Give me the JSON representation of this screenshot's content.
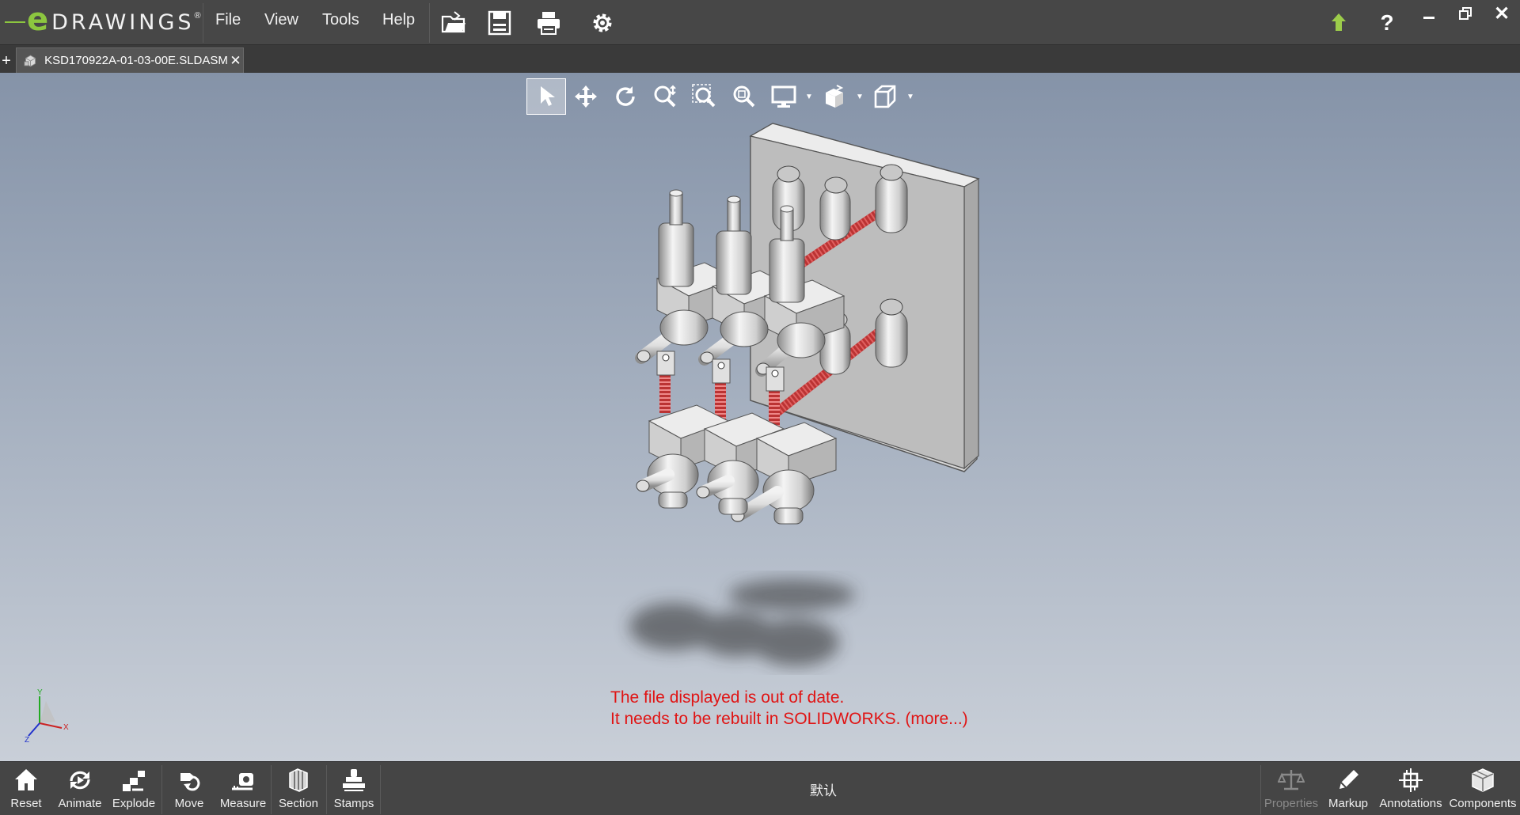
{
  "app": {
    "logo_mark": "e",
    "logo_text": "DRAWINGS",
    "logo_trademark": "®"
  },
  "menu": [
    "File",
    "View",
    "Tools",
    "Help"
  ],
  "toolbar_icons": [
    "open-folder-icon",
    "save-icon",
    "print-icon",
    "settings-gear-icon"
  ],
  "window_controls": [
    "update-arrow-icon",
    "help-icon",
    "minimize-icon",
    "restore-icon",
    "close-icon"
  ],
  "window": {
    "help": "?",
    "close": "✕"
  },
  "tabs": {
    "new_tab": "+",
    "document": {
      "name": "KSD170922A-01-03-00E.SLDASM",
      "close": "✕"
    }
  },
  "view_tools": [
    {
      "icon": "select-arrow-icon",
      "active": true
    },
    {
      "icon": "pan-icon"
    },
    {
      "icon": "rotate-icon"
    },
    {
      "icon": "zoom-icon"
    },
    {
      "icon": "zoom-to-area-icon"
    },
    {
      "icon": "zoom-to-fit-icon"
    },
    {
      "icon": "display-style-icon",
      "dropdown": true
    },
    {
      "icon": "views-icon",
      "dropdown": true
    },
    {
      "icon": "standard-view-cube-icon",
      "dropdown": true
    }
  ],
  "viewport": {
    "warning_line1": "The file displayed is out of date.",
    "warning_line2": "It needs to be rebuilt in SOLIDWORKS. (more...)",
    "warning_color": "#e01414",
    "triad": {
      "x": "X",
      "y": "Y",
      "z": "Z"
    }
  },
  "bottom_left": [
    {
      "label": "Reset",
      "icon": "home-icon"
    },
    {
      "label": "Animate",
      "icon": "animate-icon"
    },
    {
      "label": "Explode",
      "icon": "explode-icon"
    },
    {
      "label": "Move",
      "icon": "move-icon"
    },
    {
      "label": "Measure",
      "icon": "measure-icon"
    },
    {
      "label": "Section",
      "icon": "section-icon"
    },
    {
      "label": "Stamps",
      "icon": "stamps-icon"
    }
  ],
  "configuration": "默认",
  "bottom_right": [
    {
      "label": "Properties",
      "icon": "scales-icon",
      "disabled": true
    },
    {
      "label": "Markup",
      "icon": "pencil-icon"
    },
    {
      "label": "Annotations",
      "icon": "annotations-icon"
    },
    {
      "label": "Components",
      "icon": "components-cube-icon"
    }
  ],
  "colors": {
    "brand_green": "#8cc63f",
    "chrome_dark": "#474747",
    "viewport_top": "#8593a8",
    "viewport_bottom": "#c9cfd8"
  }
}
